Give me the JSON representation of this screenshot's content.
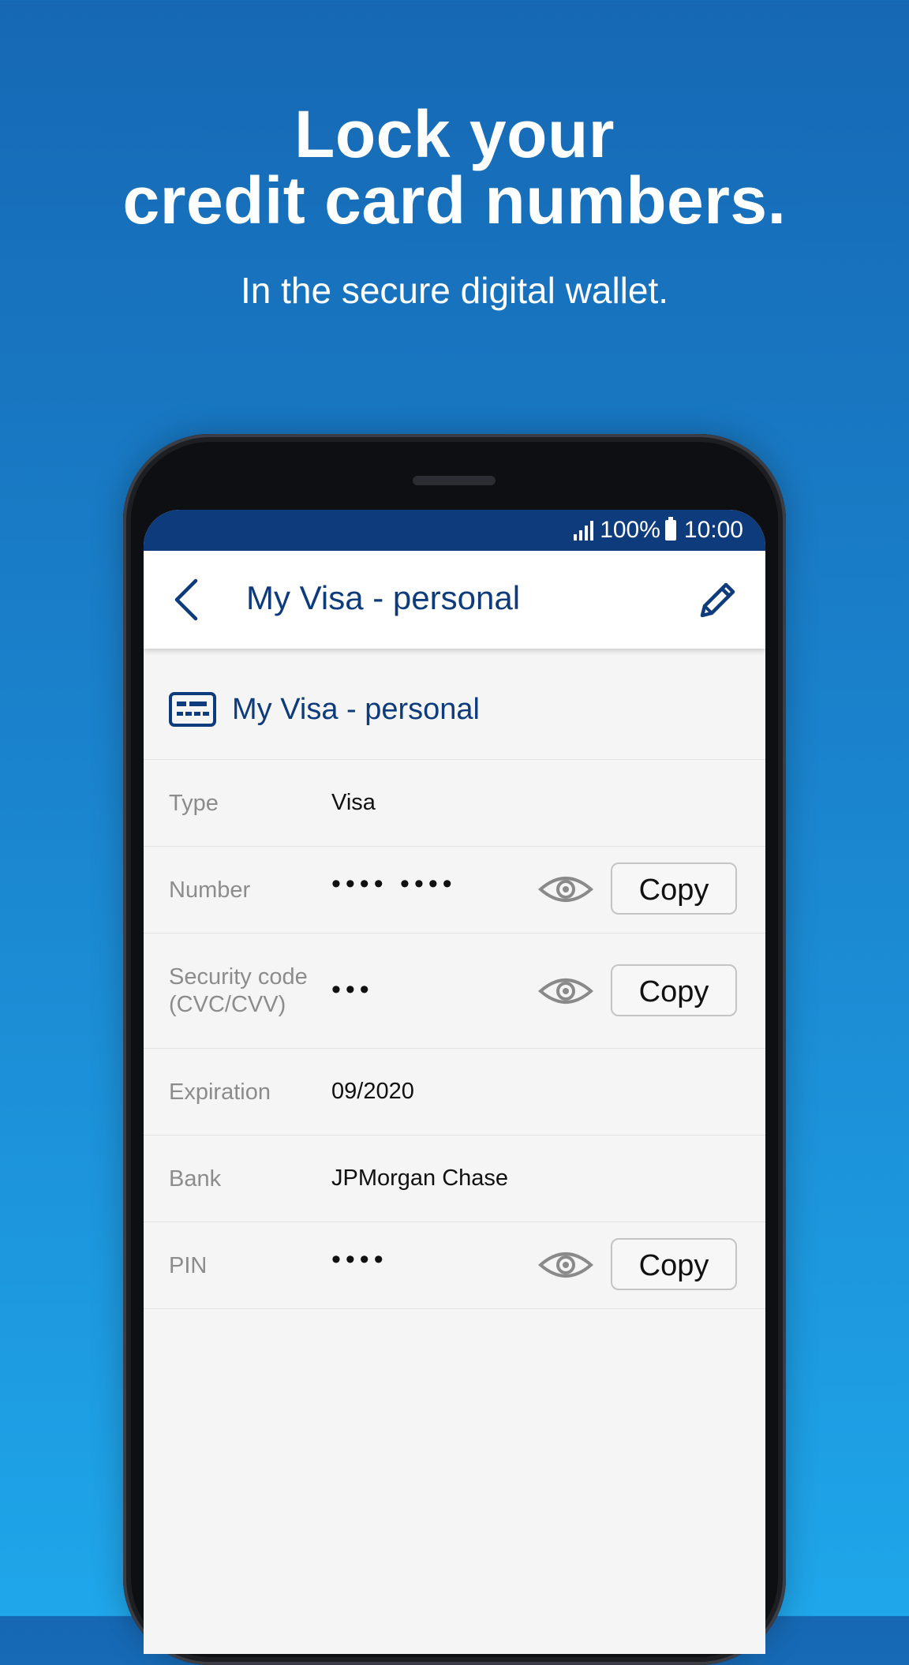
{
  "promo": {
    "headline_line1": "Lock your",
    "headline_line2": "credit card numbers.",
    "subheadline": "In the secure digital wallet."
  },
  "status_bar": {
    "battery": "100%",
    "time": "10:00"
  },
  "app_bar": {
    "title": "My Visa - personal"
  },
  "card": {
    "title": "My Visa - personal",
    "fields": [
      {
        "label": "Type",
        "value": "Visa"
      },
      {
        "label": "Number",
        "value": "•••• ••••",
        "button": "Copy"
      },
      {
        "label_line1": "Security code",
        "label_line2": "(CVC/CVV)",
        "value": "•••",
        "button": "Copy"
      },
      {
        "label": "Expiration",
        "value": "09/2020"
      },
      {
        "label": "Bank",
        "value": "JPMorgan Chase"
      },
      {
        "label": "PIN",
        "value": "••••",
        "button": "Copy"
      }
    ]
  },
  "colors": {
    "brand_navy": "#0e3b7c",
    "background_top": "#1668b4",
    "background_bottom": "#1fa6ea"
  },
  "icons": [
    "back-chevron-icon",
    "edit-pencil-icon",
    "card-icon",
    "eye-icon",
    "signal-icon",
    "battery-icon"
  ]
}
